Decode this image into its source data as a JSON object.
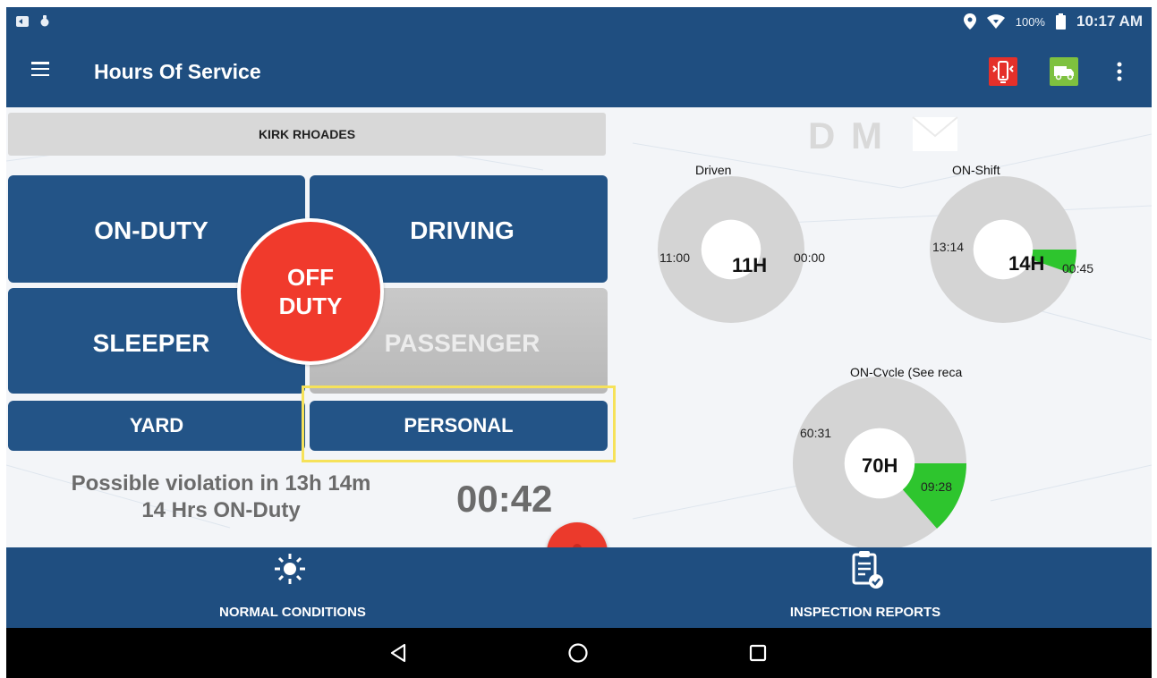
{
  "status_bar": {
    "battery": "100%",
    "time": "10:17 AM"
  },
  "app_bar": {
    "title": "Hours Of Service"
  },
  "driver": {
    "name": "KIRK RHOADES"
  },
  "badges": {
    "d": "D",
    "m": "M"
  },
  "duty_buttons": {
    "on_duty": "ON-DUTY",
    "driving": "DRIVING",
    "sleeper": "SLEEPER",
    "passenger": "PASSENGER",
    "yard": "YARD",
    "personal": "PERSONAL",
    "off_duty_line1": "OFF",
    "off_duty_line2": "DUTY"
  },
  "violation": {
    "line1": "Possible violation in 13h 14m",
    "line2": "14 Hrs ON-Duty",
    "timer": "00:42"
  },
  "charts": {
    "driven": {
      "label": "Driven",
      "center": "11H",
      "remaining": "11:00",
      "used": "00:00",
      "fraction": 0
    },
    "on_shift": {
      "label": "ON-Shift",
      "center": "14H",
      "remaining": "13:14",
      "used": "00:45",
      "fraction": 0.0536
    },
    "on_cycle": {
      "label": "ON-Cycle (See reca",
      "center": "70H",
      "remaining": "60:31",
      "used": "09:28",
      "fraction": 0.1352
    }
  },
  "bottom_bar": {
    "conditions": "NORMAL CONDITIONS",
    "inspection": "INSPECTION REPORTS"
  },
  "colors": {
    "primary": "#1f4e80",
    "button": "#235487",
    "off_duty": "#f03a2c",
    "used": "#2ec52e",
    "donut_gray": "#d4d4d4",
    "highlight": "#f6e25a"
  }
}
